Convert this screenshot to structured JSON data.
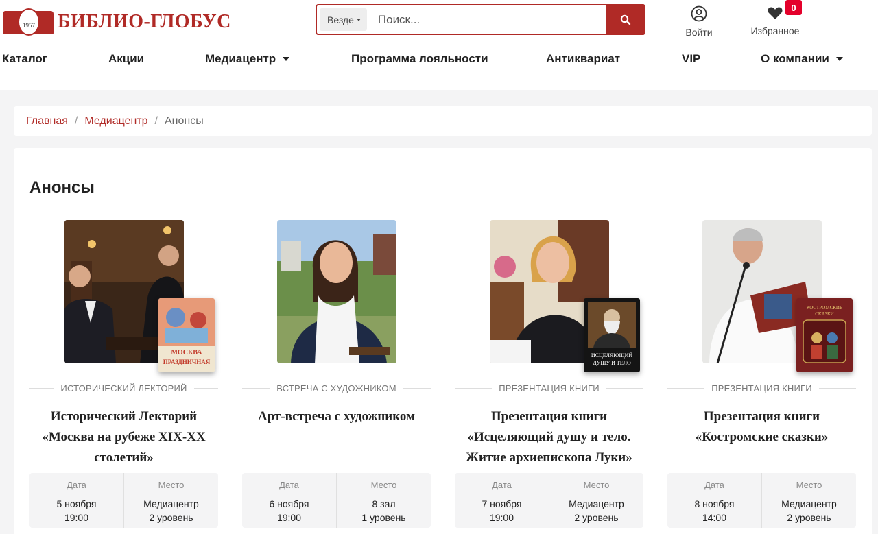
{
  "header": {
    "logo_year": "1957",
    "logo_text": "БИБЛИО-ГЛОБУС",
    "search": {
      "scope": "Везде",
      "placeholder": "Поиск..."
    },
    "login_label": "Войти",
    "favorites_label": "Избранное",
    "favorites_count": "0"
  },
  "nav": [
    {
      "label": "Каталог",
      "dropdown": false
    },
    {
      "label": "Акции",
      "dropdown": false
    },
    {
      "label": "Медиацентр",
      "dropdown": true
    },
    {
      "label": "Программа лояльности",
      "dropdown": false
    },
    {
      "label": "Антиквариат",
      "dropdown": false
    },
    {
      "label": "VIP",
      "dropdown": false
    },
    {
      "label": "О компании",
      "dropdown": true
    }
  ],
  "breadcrumb": {
    "home": "Главная",
    "section": "Медиацентр",
    "current": "Анонсы"
  },
  "page_title": "Анонсы",
  "info_headers": {
    "date": "Дата",
    "place": "Место"
  },
  "events": [
    {
      "category": "ИСТОРИЧЕСКИЙ ЛЕКТОРИЙ",
      "title": "Исторический Лекторий «Москва на рубеже XIX-XX столетий»",
      "date": "5 ноября",
      "time": "19:00",
      "place_1": "Медиацентр",
      "place_2": "2 уровень",
      "book_title": "Москва праздничная"
    },
    {
      "category": "ВСТРЕЧА С ХУДОЖНИКОМ",
      "title": "Арт-встреча с художником",
      "date": "6 ноября",
      "time": "19:00",
      "place_1": "8 зал",
      "place_2": "1 уровень"
    },
    {
      "category": "ПРЕЗЕНТАЦИЯ КНИГИ",
      "title": "Презентация книги «Исцеляющий душу и тело. Житие архиепископа Луки»",
      "date": "7 ноября",
      "time": "19:00",
      "place_1": "Медиацентр",
      "place_2": "2 уровень",
      "book_title": "Исцеляющий душу и тело"
    },
    {
      "category": "ПРЕЗЕНТАЦИЯ КНИГИ",
      "title": "Презентация книги «Костромские сказки»",
      "date": "8 ноября",
      "time": "14:00",
      "place_1": "Медиацентр",
      "place_2": "2 уровень",
      "book_title": "Костромские сказки"
    }
  ],
  "colors": {
    "brand": "#b02a26",
    "badge": "#e4002b"
  }
}
